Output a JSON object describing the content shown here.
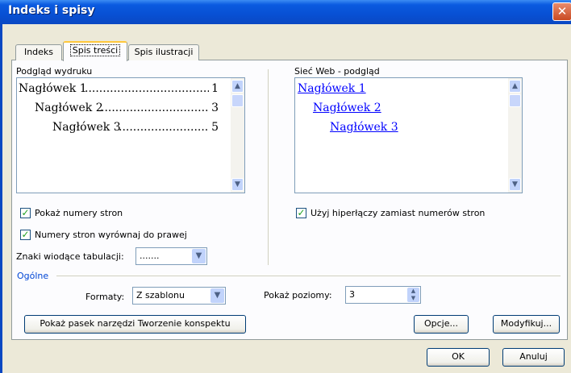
{
  "window": {
    "title": "Indeks i spisy",
    "close_glyph": "✕"
  },
  "tabs": [
    {
      "label": "Indeks",
      "active": false
    },
    {
      "label": "Spis treści",
      "active": true
    },
    {
      "label": "Spis ilustracji",
      "active": false
    }
  ],
  "print_preview": {
    "label": "Podgląd wydruku",
    "entries": [
      {
        "text": "Nagłówek 1",
        "page": "1"
      },
      {
        "text": "Nagłówek 2",
        "page": "3"
      },
      {
        "text": "Nagłówek 3",
        "page": "5"
      }
    ]
  },
  "web_preview": {
    "label": "Sieć Web - podgląd",
    "entries": [
      "Nagłówek 1",
      "Nagłówek 2",
      "Nagłówek 3"
    ]
  },
  "options": {
    "show_page_numbers": {
      "label": "Pokaż numery stron",
      "checked": true
    },
    "right_align": {
      "label": "Numery stron wyrównaj do prawej",
      "checked": true
    },
    "use_hyperlinks": {
      "label": "Użyj hiperłączy zamiast numerów stron",
      "checked": true
    },
    "tab_leader": {
      "label": "Znaki wiodące tabulacji:",
      "value": "......."
    }
  },
  "general": {
    "title": "Ogólne",
    "formats": {
      "label": "Formaty:",
      "value": "Z szablonu"
    },
    "levels": {
      "label": "Pokaż poziomy:",
      "value": "3"
    }
  },
  "buttons": {
    "outline_toolbar": "Pokaż pasek narzędzi Tworzenie konspektu",
    "options": "Opcje...",
    "modify": "Modyfikuj...",
    "ok": "OK",
    "cancel": "Anuluj"
  },
  "colors": {
    "titlebar": "#0a5ae0",
    "face": "#ece9d8",
    "link": "#0000ff",
    "group_title": "#0046d5"
  }
}
